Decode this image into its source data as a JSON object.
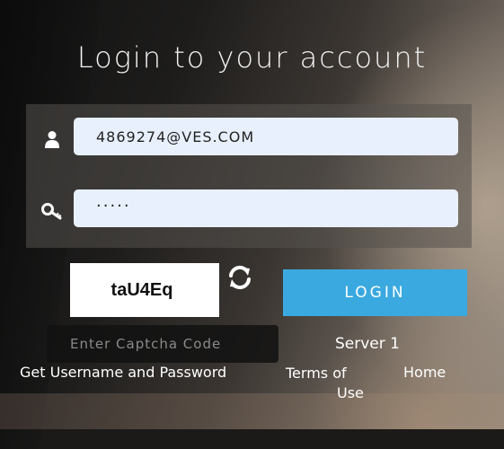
{
  "login": {
    "title": "Login to your account",
    "email_value": "4869274@VES.COM",
    "password_value": "·····",
    "captcha_text": "taU4Eq",
    "captcha_placeholder": "Enter Captcha Code",
    "login_button": "LOGIN",
    "server": "Server 1"
  },
  "links": {
    "credentials": "Get Username and Password",
    "terms_line1": "Terms of",
    "terms_line2": "Use",
    "home": "Home"
  },
  "icons": {
    "user": "user-icon",
    "key": "key-icon",
    "refresh": "refresh-icon"
  },
  "colors": {
    "login_button": "#3aa9e0",
    "field_background": "#e8f0fe"
  }
}
